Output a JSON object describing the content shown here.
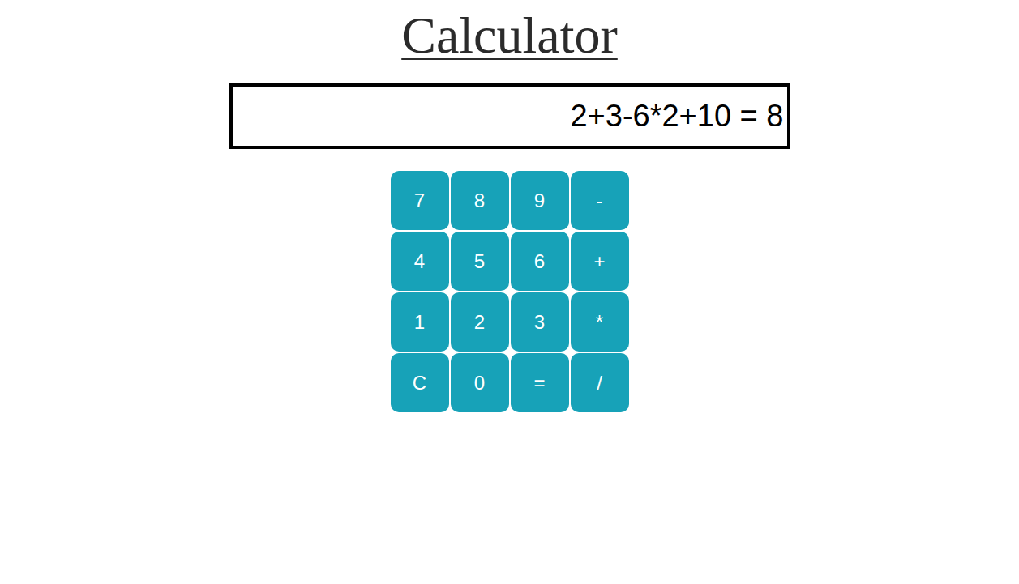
{
  "title": "Calculator",
  "display": "2+3-6*2+10 = 8",
  "keys": [
    "7",
    "8",
    "9",
    "-",
    "4",
    "5",
    "6",
    "+",
    "1",
    "2",
    "3",
    "*",
    "C",
    "0",
    "=",
    "/"
  ]
}
